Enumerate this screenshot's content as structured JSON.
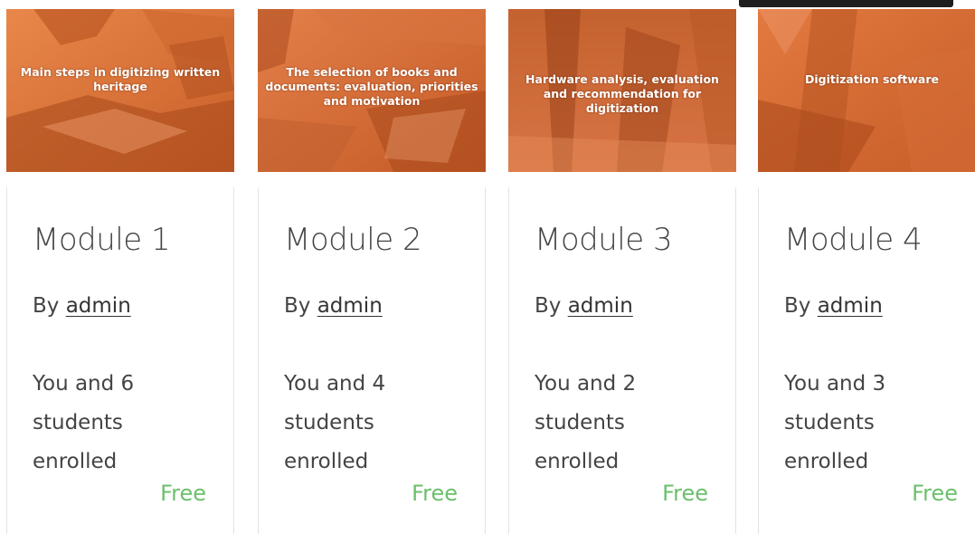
{
  "theme": {
    "thumb_bg_light": "#e57b3e",
    "thumb_bg_dark": "#b5511f",
    "price_color": "#6cbf6c",
    "text_color": "#444444"
  },
  "courses": [
    {
      "thumbnail_text": "Main steps in digitizing written heritage",
      "title": "Module 1",
      "by_label": "By",
      "author": "admin",
      "enrolled": "You and 6 students enrolled",
      "price": "Free"
    },
    {
      "thumbnail_text": "The selection of books and documents: evaluation, priorities and motivation",
      "title": "Module 2",
      "by_label": "By",
      "author": "admin",
      "enrolled": "You and 4 students enrolled",
      "price": "Free"
    },
    {
      "thumbnail_text": "Hardware analysis, evaluation and recommendation for digitization",
      "title": "Module 3",
      "by_label": "By",
      "author": "admin",
      "enrolled": "You and 2 students enrolled",
      "price": "Free"
    },
    {
      "thumbnail_text": "Digitization software",
      "title": "Module 4",
      "by_label": "By",
      "author": "admin",
      "enrolled": "You and 3 students enrolled",
      "price": "Free"
    }
  ]
}
